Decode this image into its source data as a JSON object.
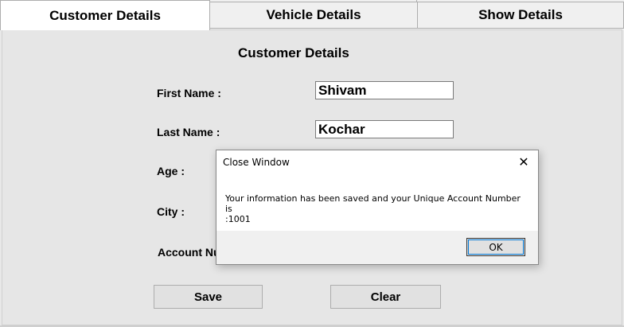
{
  "tabs": [
    {
      "label": "Customer Details",
      "active": true
    },
    {
      "label": "Vehicle Details",
      "active": false
    },
    {
      "label": "Show Details",
      "active": false
    }
  ],
  "form": {
    "title": "Customer Details",
    "first_name_label": "First Name :",
    "first_name_value": "Shivam",
    "last_name_label": "Last Name :",
    "last_name_value": "Kochar",
    "age_label": "Age :",
    "city_label": "City :",
    "account_label": "Account Nu",
    "save_label": "Save",
    "clear_label": "Clear"
  },
  "dialog": {
    "title": "Close Window",
    "close_glyph": "✕",
    "message": "Your information has been saved and your Unique Account Number is\n:1001",
    "ok_label": "OK"
  },
  "colors": {
    "panel_bg": "#e6e6e6",
    "focus_outline": "#0078d7"
  }
}
